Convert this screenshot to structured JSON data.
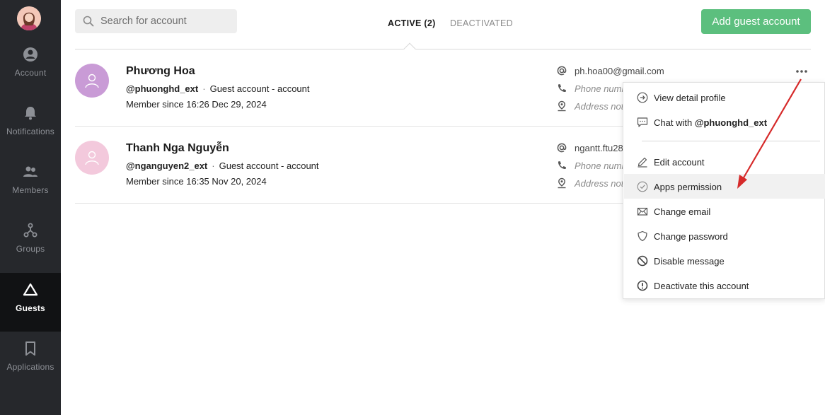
{
  "sidebar": {
    "items": [
      {
        "label": "Account",
        "icon": "account-circle-icon"
      },
      {
        "label": "Notifications",
        "icon": "bell-icon"
      },
      {
        "label": "Members",
        "icon": "members-icon"
      },
      {
        "label": "Groups",
        "icon": "groups-icon"
      },
      {
        "label": "Guests",
        "icon": "triangle-icon",
        "active": true
      },
      {
        "label": "Applications",
        "icon": "bookmark-icon"
      }
    ]
  },
  "search": {
    "placeholder": "Search for account",
    "value": ""
  },
  "tabs": [
    {
      "label": "ACTIVE (2)",
      "active": true
    },
    {
      "label": "DEACTIVATED",
      "active": false
    }
  ],
  "add_button": "Add guest account",
  "accounts": [
    {
      "name": "Phương Hoa",
      "handle": "@phuonghd_ext",
      "separator": "·",
      "type": "Guest account - account",
      "since": "Member since 16:26 Dec 29, 2024",
      "email": "ph.hoa00@gmail.com",
      "phone": "Phone numb",
      "address": "Address not",
      "avatar_color": "#c99bd6"
    },
    {
      "name": "Thanh Nga Nguyễn",
      "handle": "@nganguyen2_ext",
      "separator": "·",
      "type": "Guest account - account",
      "since": "Member since 16:35 Nov 20, 2024",
      "email": "ngantt.ftu28",
      "phone": "Phone numb",
      "address": "Address not",
      "avatar_color": "#f3c9dc"
    }
  ],
  "menu": {
    "view_profile": "View detail profile",
    "chat_prefix": "Chat with ",
    "chat_handle": "@phuonghd_ext",
    "edit_account": "Edit account",
    "apps_permission": "Apps permission",
    "change_email": "Change email",
    "change_password": "Change password",
    "disable_message": "Disable message",
    "deactivate": "Deactivate this account"
  },
  "colors": {
    "sidebar_bg": "#26282c",
    "accent_green": "#5cbf7e",
    "annotation_arrow": "#d62a2a"
  }
}
